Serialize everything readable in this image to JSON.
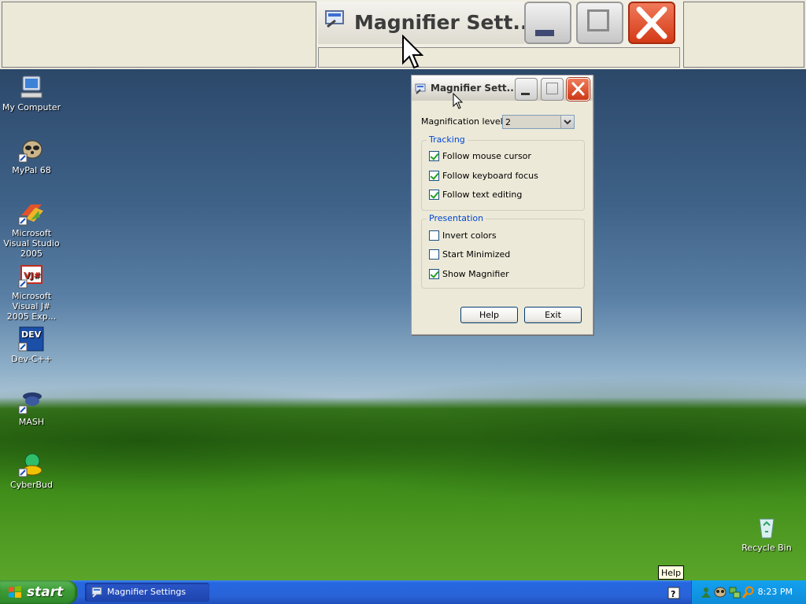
{
  "magnifier": {
    "title": "Magnifier Sett..."
  },
  "desktop_icons": [
    {
      "label": "My Computer"
    },
    {
      "label": "MyPal 68"
    },
    {
      "label": "Microsoft Visual Studio 2005"
    },
    {
      "label": "Microsoft Visual J# 2005 Exp..."
    },
    {
      "label": "Dev-C++"
    },
    {
      "label": "MASH"
    },
    {
      "label": "CyberBud"
    },
    {
      "label": "Recycle Bin"
    }
  ],
  "settings_window": {
    "title": "Magnifier Sett...",
    "magnification_label": "Magnification level:",
    "magnification_value": "2",
    "tracking": {
      "title": "Tracking",
      "options": [
        {
          "label": "Follow mouse cursor",
          "checked": true
        },
        {
          "label": "Follow keyboard focus",
          "checked": true
        },
        {
          "label": "Follow text editing",
          "checked": true
        }
      ]
    },
    "presentation": {
      "title": "Presentation",
      "options": [
        {
          "label": "Invert colors",
          "checked": false
        },
        {
          "label": "Start Minimized",
          "checked": false
        },
        {
          "label": "Show Magnifier",
          "checked": true
        }
      ]
    },
    "help_button": "Help",
    "exit_button": "Exit"
  },
  "tooltip": "Help",
  "taskbar": {
    "start_label": "start",
    "task_button": "Magnifier Settings",
    "clock": "8:23 PM"
  },
  "colors": {
    "group_title": "#0046d5",
    "taskbar": "#2567e0",
    "start": "#3c9a34",
    "tray": "#0d8dda",
    "close_button": "#d43a16"
  }
}
